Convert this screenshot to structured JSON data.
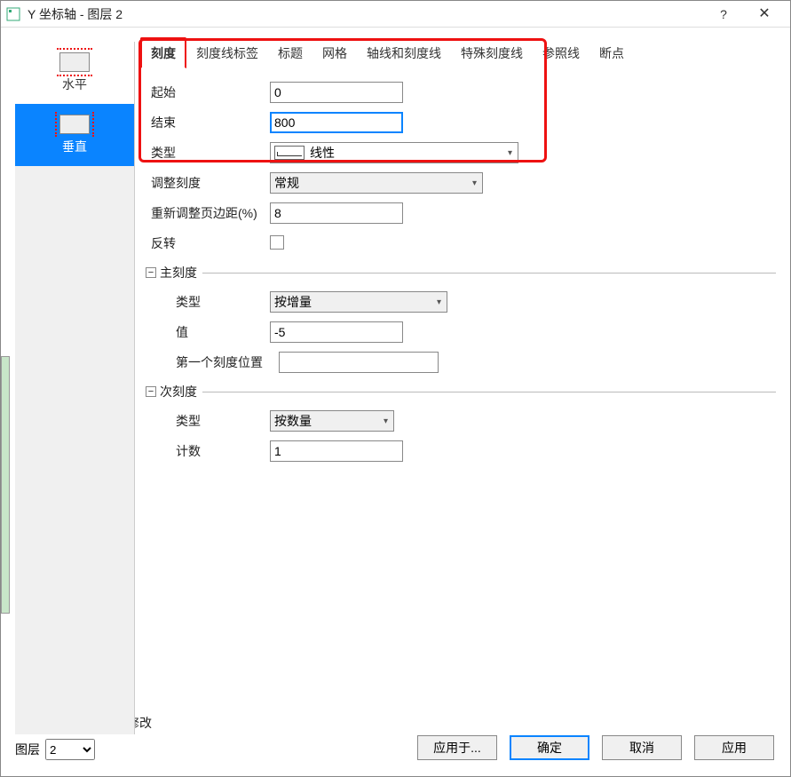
{
  "window": {
    "title": "Y 坐标轴 - 图层 2"
  },
  "sysbuttons": {
    "help": "?",
    "close": "✕"
  },
  "sidebar": {
    "items": [
      {
        "label": "水平"
      },
      {
        "label": "垂直"
      }
    ]
  },
  "tabs": [
    {
      "label": "刻度"
    },
    {
      "label": "刻度线标签"
    },
    {
      "label": "标题"
    },
    {
      "label": "网格"
    },
    {
      "label": "轴线和刻度线"
    },
    {
      "label": "特殊刻度线"
    },
    {
      "label": "参照线"
    },
    {
      "label": "断点"
    }
  ],
  "form": {
    "start_label": "起始",
    "start_value": "0",
    "end_label": "结束",
    "end_value": "800",
    "type_label": "类型",
    "type_value": "线性",
    "adjust_label": "调整刻度",
    "adjust_value": "常规",
    "margin_label": "重新调整页边距(%)",
    "margin_value": "8",
    "reverse_label": "反转",
    "major": {
      "legend": "主刻度",
      "type_label": "类型",
      "type_value": "按增量",
      "value_label": "值",
      "value_value": "-5",
      "firsttick_label": "第一个刻度位置",
      "firsttick_value": ""
    },
    "minor": {
      "legend": "次刻度",
      "type_label": "类型",
      "type_value": "按数量",
      "count_label": "计数",
      "count_value": "1"
    }
  },
  "footer": {
    "note": "选中多个轴同时进行修改",
    "layer_label": "图层",
    "layer_value": "2",
    "apply_to": "应用于...",
    "ok": "确定",
    "cancel": "取消",
    "apply": "应用"
  }
}
